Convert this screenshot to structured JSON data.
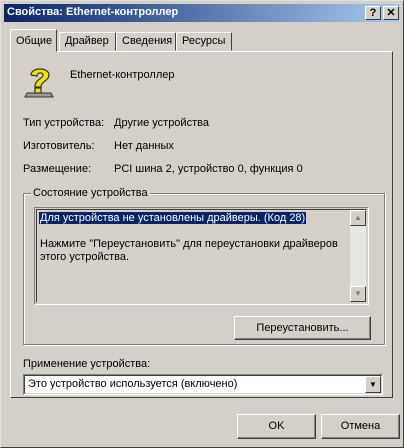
{
  "window": {
    "title": "Свойства: Ethernet-контроллер",
    "help": "?",
    "close": "✕"
  },
  "tabs": [
    {
      "label": "Общие"
    },
    {
      "label": "Драйвер"
    },
    {
      "label": "Сведения"
    },
    {
      "label": "Ресурсы"
    }
  ],
  "device": {
    "name": "Ethernet-контроллер",
    "icon": "unknown-device-question-icon"
  },
  "properties": [
    {
      "label": "Тип устройства:",
      "value": "Другие устройства"
    },
    {
      "label": "Изготовитель:",
      "value": "Нет данных"
    },
    {
      "label": "Размещение:",
      "value": "PCI шина 2, устройство 0, функция 0"
    }
  ],
  "status": {
    "caption": "Состояние устройства",
    "line1": "Для устройства не установлены драйверы. (Код 28)",
    "line2": "Нажмите \"Переустановить\" для переустановки драйверов этого устройства.",
    "reinstall_label": "Переустановить..."
  },
  "usage": {
    "label": "Применение устройства:",
    "value": "Это устройство используется (включено)"
  },
  "buttons": {
    "ok": "OK",
    "cancel": "Отмена"
  },
  "colors": {
    "titlebar_start": "#0a246a",
    "titlebar_end": "#a6caf0",
    "selection": "#0a246a",
    "face": "#d4d0c8",
    "icon_yellow": "#f2e200"
  }
}
